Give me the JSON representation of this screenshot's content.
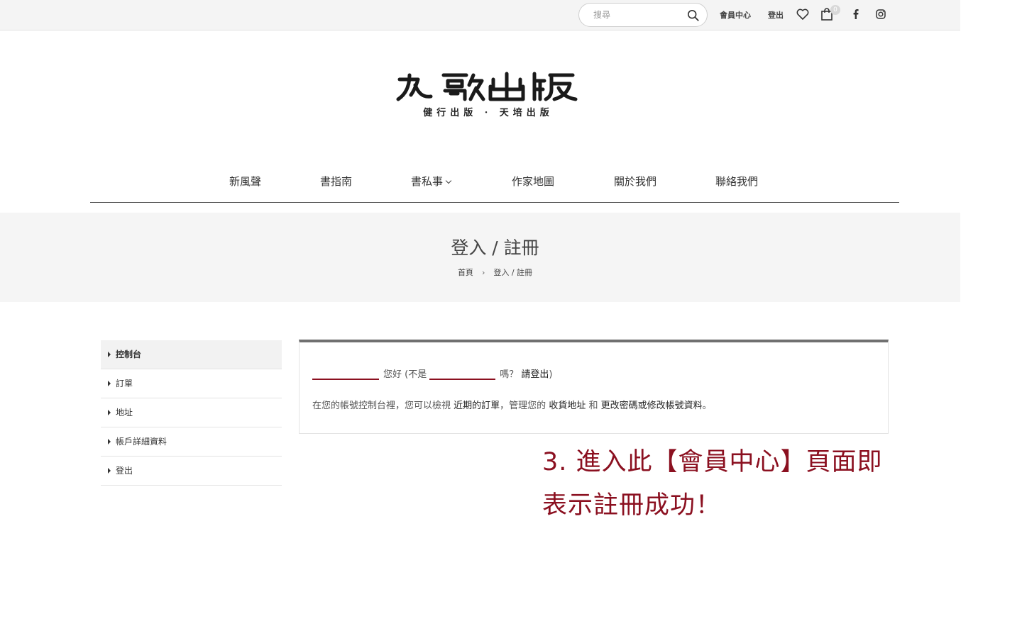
{
  "topbar": {
    "search_placeholder": "搜尋",
    "member_center": "會員中心",
    "logout": "登出",
    "cart_count": "0",
    "icons": [
      "search-icon",
      "heart-icon",
      "shopping-bag-icon",
      "facebook-icon",
      "instagram-icon"
    ]
  },
  "logo": {
    "main": "九歌出版",
    "sub": "健行出版 · 天培出版"
  },
  "nav": {
    "items": [
      {
        "label": "新風聲"
      },
      {
        "label": "書指南"
      },
      {
        "label": "書私事"
      },
      {
        "label": "作家地圖"
      },
      {
        "label": "關於我們"
      },
      {
        "label": "聯絡我們"
      }
    ]
  },
  "banner": {
    "title": "登入 / 註冊",
    "breadcrumb_home": "首頁",
    "breadcrumb_sep": "›",
    "breadcrumb_current": "登入 / 註冊"
  },
  "sidebar": {
    "items": [
      {
        "label": "控制台"
      },
      {
        "label": "訂單"
      },
      {
        "label": "地址"
      },
      {
        "label": "帳戶詳細資料"
      },
      {
        "label": "登出"
      }
    ]
  },
  "dashboard": {
    "hello": "您好 (不是",
    "question": "嗎？",
    "logout_link": "請登出",
    "close_paren": ")",
    "desc_1": "在您的帳號控制台裡，您可以檢視",
    "orders_link": "近期的訂單",
    "desc_2": "，管理您的",
    "address_link": "收貨地址",
    "desc_3": "和",
    "account_link": "更改密碼或修改帳號資料",
    "desc_4": "。"
  },
  "annotation": {
    "line1": "3. 進入此【會員中心】頁面即",
    "line2": "表示註冊成功！"
  },
  "colors": {
    "annotation": "#8b1020",
    "topbar_bg": "#f4f4f4",
    "banner_bg": "#f5f5f5"
  }
}
